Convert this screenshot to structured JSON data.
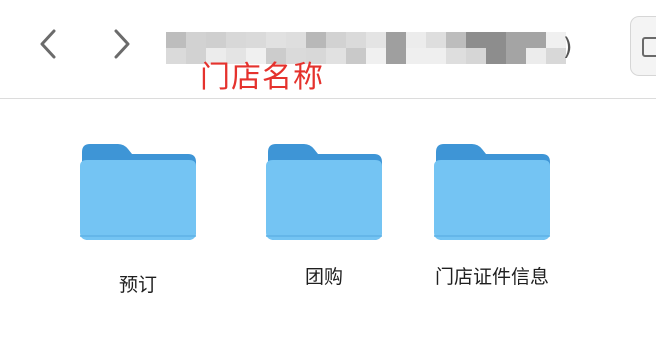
{
  "toolbar": {
    "back_icon": "chevron-left-icon",
    "forward_icon": "chevron-right-icon",
    "path_tail": ")",
    "edge_icon": "view-options-icon"
  },
  "annotation": {
    "text": "门店名称",
    "color": "#e5322d"
  },
  "folders": [
    {
      "label": "预订",
      "icon": "folder-icon"
    },
    {
      "label": "团购",
      "icon": "folder-icon"
    },
    {
      "label": "门店证件信息",
      "icon": "folder-icon"
    }
  ],
  "colors": {
    "folder_front": "#74c4f3",
    "folder_back": "#3e95d6",
    "chevron": "#6b6b6b"
  }
}
